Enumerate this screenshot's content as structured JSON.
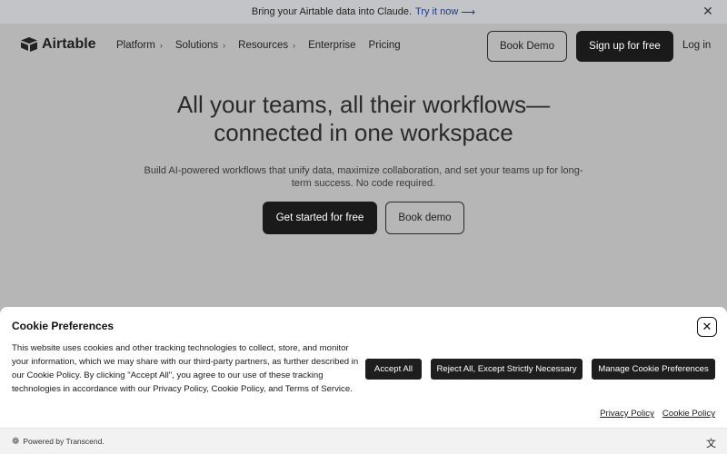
{
  "banner": {
    "text": "Bring your Airtable data into Claude.",
    "link": "Try it now",
    "arrow": "⟶",
    "close": "✕"
  },
  "nav": {
    "logo": "Airtable",
    "items": [
      {
        "label": "Platform",
        "chevron": "›"
      },
      {
        "label": "Solutions",
        "chevron": "›"
      },
      {
        "label": "Resources",
        "chevron": "›"
      },
      {
        "label": "Enterprise"
      },
      {
        "label": "Pricing"
      }
    ],
    "book_demo": "Book Demo",
    "signup": "Sign up for free",
    "login": "Log in"
  },
  "hero": {
    "title_line1": "All your teams, all their workflows—",
    "title_line2": "connected in one workspace",
    "subtitle": "Build AI-powered workflows that unify data, maximize collaboration, and set your teams up for long-term success. No code required.",
    "cta_primary": "Get started for free",
    "cta_secondary": "Book demo"
  },
  "cookie": {
    "title": "Cookie Preferences",
    "close": "✕",
    "body": "This website uses cookies and other tracking technologies to collect, store, and monitor your information, which we may share with our third-party partners, as further described in our Cookie Policy. By clicking \"Accept All\", you agree to our use of these tracking technologies in accordance with our Privacy Policy, Cookie Policy, and Terms of Service.",
    "accept_all": "Accept All",
    "reject_all": "Reject All, Except Strictly Necessary",
    "manage": "Manage Cookie Preferences",
    "privacy_policy": "Privacy Policy",
    "cookie_policy": "Cookie Policy",
    "powered_by": "Powered by Transcend.",
    "powered_icon": "❁",
    "translate_icon": "文"
  },
  "colors": {
    "overlay_bg": "#b6b6b6",
    "banner_bg": "#c3c4c7",
    "dark_button": "#1a1a1a",
    "link_blue": "#1b3a8a"
  }
}
